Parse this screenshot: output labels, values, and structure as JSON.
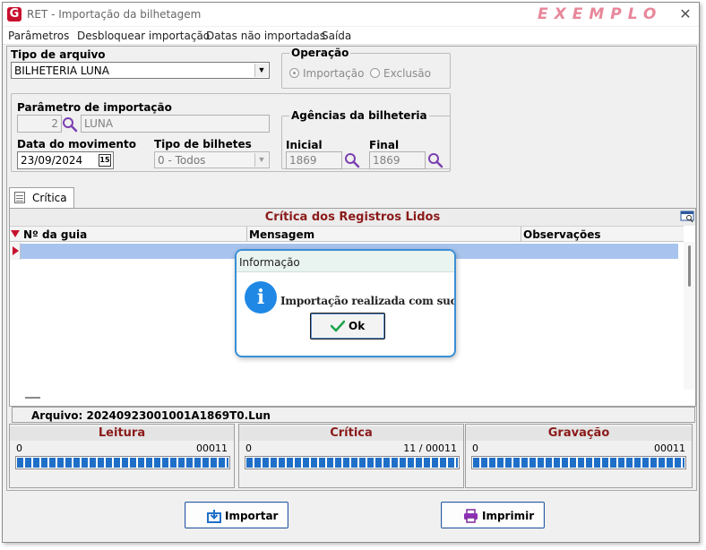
{
  "window": {
    "title": "RET - Importação da bilhetagem",
    "watermark": "EXEMPLO",
    "close_glyph": "✕"
  },
  "menu": [
    {
      "label": "Parâmetros"
    },
    {
      "label": "Desbloquear importação"
    },
    {
      "label": "Datas não importadas"
    },
    {
      "label": "Saída"
    }
  ],
  "form": {
    "tipo_arquivo_label": "Tipo de arquivo",
    "tipo_arquivo_value": "BILHETERIA LUNA",
    "operacao_label": "Operação",
    "operacao_options": [
      {
        "label": "Importação",
        "selected": true
      },
      {
        "label": "Exclusão",
        "selected": false
      }
    ],
    "param_label": "Parâmetro de importação",
    "param_code": "2",
    "param_name": "LUNA",
    "data_label": "Data do movimento",
    "data_value": "23/09/2024",
    "calendar_glyph": "15",
    "tipo_bilhetes_label": "Tipo de bilhetes",
    "tipo_bilhetes_value": "0 - Todos",
    "agencias_label": "Agências da bilheteria",
    "inicial_label": "Inicial",
    "inicial_value": "1869",
    "final_label": "Final",
    "final_value": "1869"
  },
  "tab": {
    "label": "Crítica"
  },
  "grid": {
    "title": "Crítica dos Registros Lidos",
    "columns": [
      "Nº da guia",
      "Mensagem",
      "Observações"
    ]
  },
  "file": {
    "text": "Arquivo: 20240923001001A1869T0.Lun"
  },
  "progress": [
    {
      "title": "Leitura",
      "min": "0",
      "max": "00011",
      "fraction": 1.0
    },
    {
      "title": "Crítica",
      "min": "0",
      "max": "11 / 00011",
      "fraction": 1.0
    },
    {
      "title": "Gravação",
      "min": "0",
      "max": "00011",
      "fraction": 1.0
    }
  ],
  "buttons": {
    "importar": "Importar",
    "imprimir": "Imprimir"
  },
  "dialog": {
    "title": "Informação",
    "message": "Importação realizada com sucesso.",
    "ok_label": "Ok",
    "icon_glyph": "i"
  },
  "colors": {
    "accent_red": "#8b1a1a",
    "progress_blue": "#1f6fc8",
    "dialog_border": "#3a8fd6",
    "selection": "#a8c4ee"
  }
}
